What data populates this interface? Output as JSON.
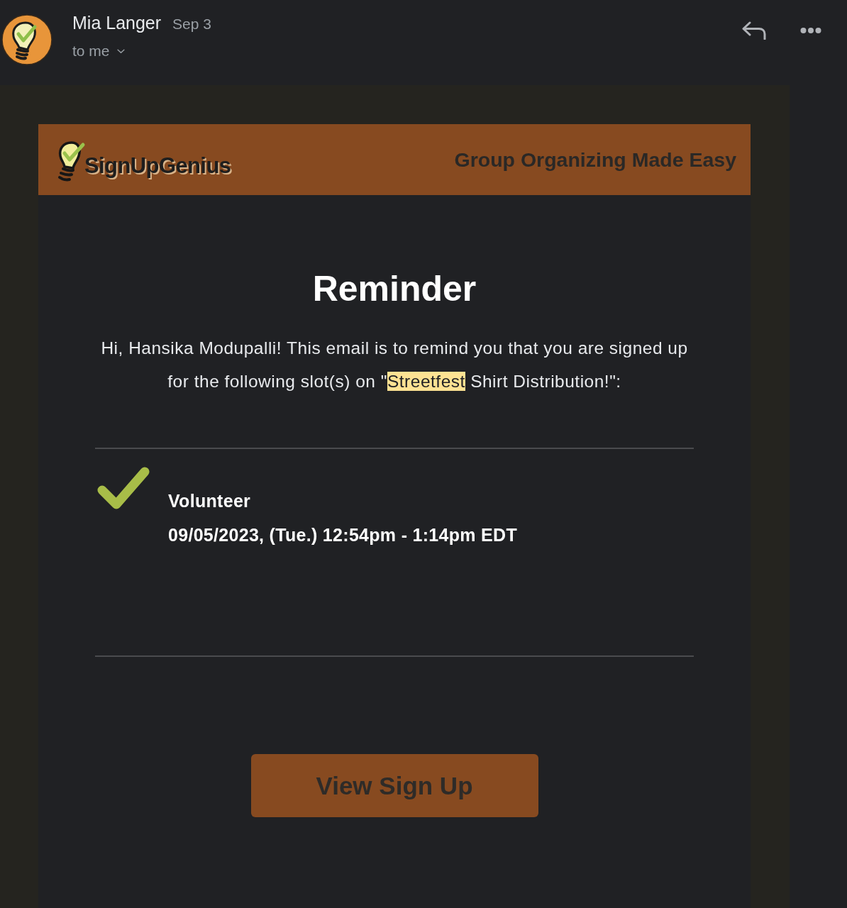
{
  "message_header": {
    "sender": "Mia Langer",
    "date": "Sep 3",
    "recipient": "to me"
  },
  "email": {
    "banner": {
      "brand": "SignUpGenius",
      "tagline": "Group Organizing Made Easy"
    },
    "title": "Reminder",
    "intro": [
      {
        "text": "Hi, Hansika Modupalli! This email is to remind you that you are signed up for the following slot(s) on \"",
        "highlighted": false
      },
      {
        "text": "Streetfest",
        "highlighted": true
      },
      {
        "text": " Shirt Distribution!\":",
        "highlighted": false
      }
    ],
    "slots": [
      {
        "role": "Volunteer",
        "time": "09/05/2023, (Tue.) 12:54pm - 1:14pm EDT"
      }
    ],
    "button": "View Sign Up"
  }
}
